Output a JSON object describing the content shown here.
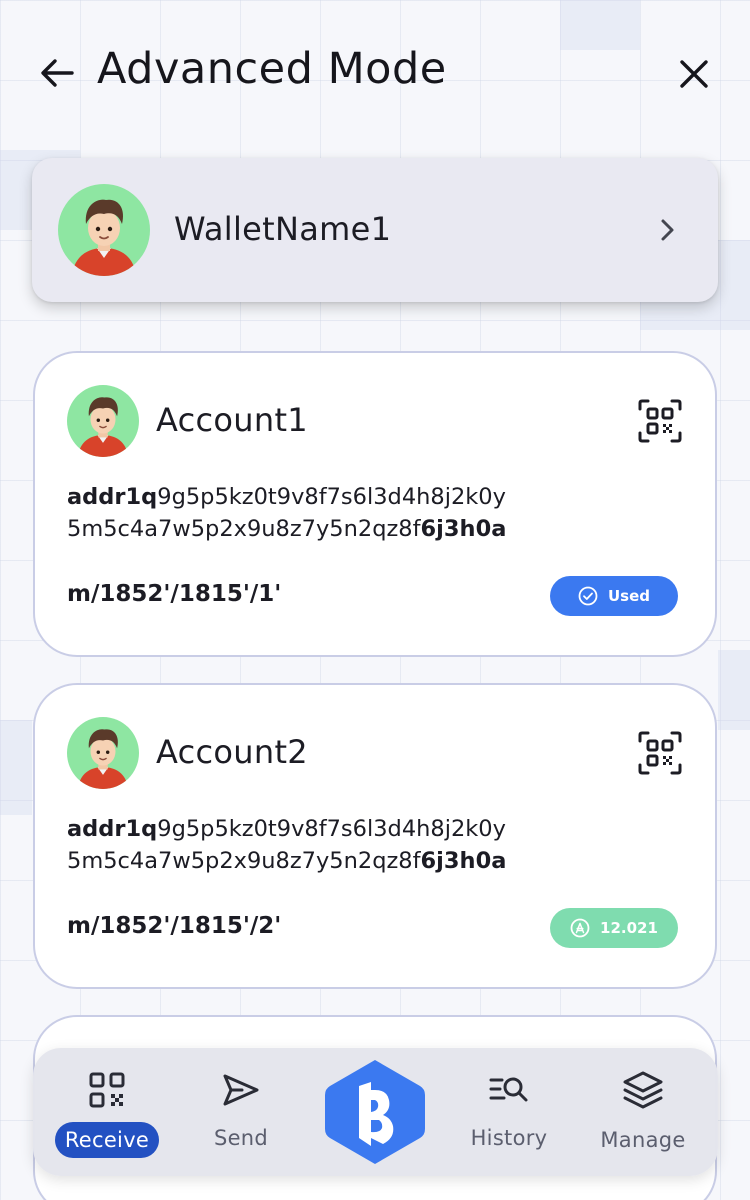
{
  "header": {
    "title": "Advanced Mode",
    "back_icon": "arrow-left-icon",
    "close_icon": "close-icon"
  },
  "wallet": {
    "name": "WalletName1",
    "avatar": "avatar-icon",
    "chevron_icon": "chevron-right-icon"
  },
  "accounts": [
    {
      "name": "Account1",
      "address_prefix": "addr1q",
      "address_middle_line1": "9g5p5kz0t9v8f7s6l3d4h8j2k0y",
      "address_middle_line2": "5m5c4a7w5p2x9u8z7y5n2qz8f",
      "address_suffix": "6j3h0a",
      "path": "m/1852'/1815'/1'",
      "badge_label": "Used",
      "badge_icon": "check-circle-icon",
      "badge_color": "#3b79f0"
    },
    {
      "name": "Account2",
      "address_prefix": "addr1q",
      "address_middle_line1": "9g5p5kz0t9v8f7s6l3d4h8j2k0y",
      "address_middle_line2": "5m5c4a7w5p2x9u8z7y5n2qz8f",
      "address_suffix": "6j3h0a",
      "path": "m/1852'/1815'/2'",
      "badge_label": "12.021",
      "badge_icon": "ada-icon",
      "badge_color": "#7fdcaf"
    }
  ],
  "nav": {
    "items": [
      {
        "label": "Receive",
        "icon": "qr-code-icon",
        "active": true
      },
      {
        "label": "Send",
        "icon": "send-icon",
        "active": false
      },
      {
        "label": "History",
        "icon": "history-search-icon",
        "active": false
      },
      {
        "label": "Manage",
        "icon": "layers-icon",
        "active": false
      }
    ],
    "center_icon": "brand-logo-icon",
    "active_color": "#2351c2",
    "brand_color": "#3b79f0"
  }
}
